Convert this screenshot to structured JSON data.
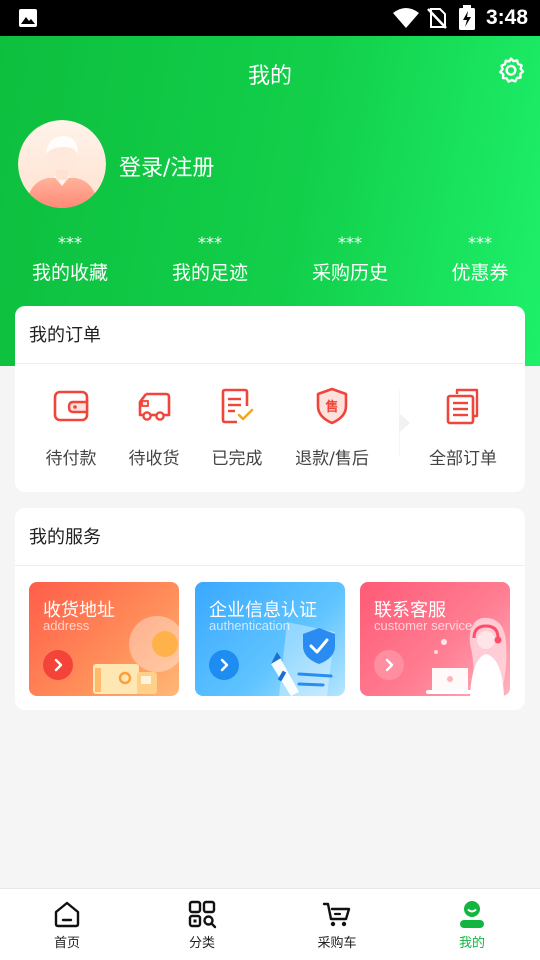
{
  "status_bar": {
    "time": "3:48"
  },
  "header": {
    "title": "我的",
    "login_label": "登录/注册"
  },
  "stats": [
    {
      "value": "***",
      "label": "我的收藏"
    },
    {
      "value": "***",
      "label": "我的足迹"
    },
    {
      "value": "***",
      "label": "采购历史"
    },
    {
      "value": "***",
      "label": "优惠券"
    }
  ],
  "orders": {
    "title": "我的订单",
    "items": [
      {
        "label": "待付款",
        "icon": "wallet-icon"
      },
      {
        "label": "待收货",
        "icon": "delivery-truck-icon"
      },
      {
        "label": "已完成",
        "icon": "checklist-icon"
      },
      {
        "label": "退款/售后",
        "icon": "after-sale-shield-icon"
      },
      {
        "label": "全部订单",
        "icon": "all-orders-icon"
      }
    ],
    "after_sale_glyph": "售"
  },
  "services": {
    "title": "我的服务",
    "items": [
      {
        "title": "收货地址",
        "subtitle": "address"
      },
      {
        "title": "企业信息认证",
        "subtitle": "authentication"
      },
      {
        "title": "联系客服",
        "subtitle": "customer service"
      }
    ]
  },
  "tabbar": {
    "items": [
      {
        "label": "首页",
        "icon": "home-icon"
      },
      {
        "label": "分类",
        "icon": "category-icon"
      },
      {
        "label": "采购车",
        "icon": "cart-icon"
      },
      {
        "label": "我的",
        "icon": "profile-icon"
      }
    ],
    "active_index": 3
  },
  "colors": {
    "brand_green": "#13b541",
    "order_icon_red": "#f0453a",
    "address_card": "#ff6a4d",
    "auth_card": "#3aa8ff",
    "contact_card": "#ff5a76"
  }
}
